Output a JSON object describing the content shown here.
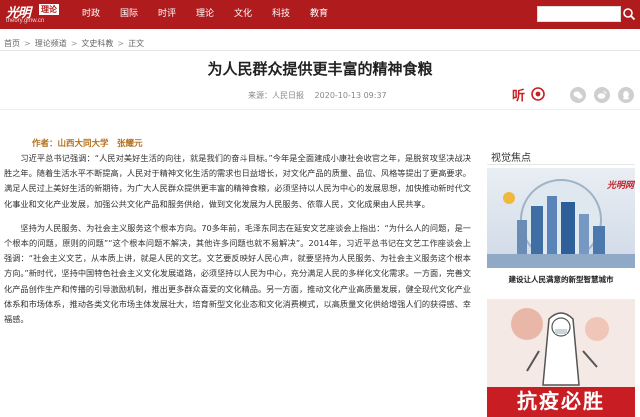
{
  "site": {
    "logo_text": "光明",
    "logo_badge": "理论",
    "logo_url": "theory.gmw.cn"
  },
  "nav": {
    "items": [
      "时政",
      "国际",
      "时评",
      "理论",
      "文化",
      "科技",
      "教育"
    ]
  },
  "search": {
    "placeholder": ""
  },
  "breadcrumb": {
    "items": [
      "首页",
      "理论频道",
      "文史科教",
      "正文"
    ],
    "separator": ">"
  },
  "article": {
    "title": "为人民群众提供更丰富的精神食粮",
    "source": "来源：人民日报",
    "date": "2020-10-13 09:37",
    "listen_label": "听",
    "author_line": "作者：山西大同大学　张耀元",
    "paragraphs": [
      "习近平总书记强调：“人民对美好生活的向往，就是我们的奋斗目标。”今年是全面建成小康社会收官之年，是脱贫攻坚决战决胜之年。随着生活水平不断提高，人民对于精神文化生活的需求也日益增长，对文化产品的质量、品位、风格等提出了更高要求。满足人民过上美好生活的新期待，为广大人民群众提供更丰富的精神食粮，必须坚持以人民为中心的发展思想，加快推动新时代文化事业和文化产业发展，加强公共文化产品和服务供给，做到文化发展为人民服务、依靠人民，文化成果由人民共享。",
      "坚持为人民服务、为社会主义服务这个根本方向。70多年前，毛泽东同志在延安文艺座谈会上指出：“为什么人的问题，是一个根本的问题，原则的问题”“这个根本问题不解决，其他许多问题也就不易解决”。2014年，习近平总书记在文艺工作座谈会上强调：“社会主义文艺，从本质上讲，就是人民的文艺。文艺要反映好人民心声，就要坚持为人民服务、为社会主义服务这个根本方向。”新时代，坚持中国特色社会主义文化发展道路，必须坚持以人民为中心，充分满足人民的多样化文化需求。一方面，完善文化产品创作生产和传播的引导激励机制，推出更多群众喜爱的文化精品。另一方面，推动文化产业高质量发展，健全现代文化产业体系和市场体系，推动各类文化市场主体发展壮大，培育新型文化业态和文化消费模式，以高质量文化供给增强人们的获得感、幸福感。"
    ]
  },
  "sidebar": {
    "heading": "视觉焦点",
    "items": [
      {
        "caption": "建设让人民满意的新型智慧城市",
        "image_text": "光明网"
      },
      {
        "caption": "",
        "image_text": "抗疫必胜"
      }
    ]
  },
  "colors": {
    "brand_red": "#b01c1e",
    "author_color": "#b5701c",
    "listen_red": "#c81f22"
  }
}
